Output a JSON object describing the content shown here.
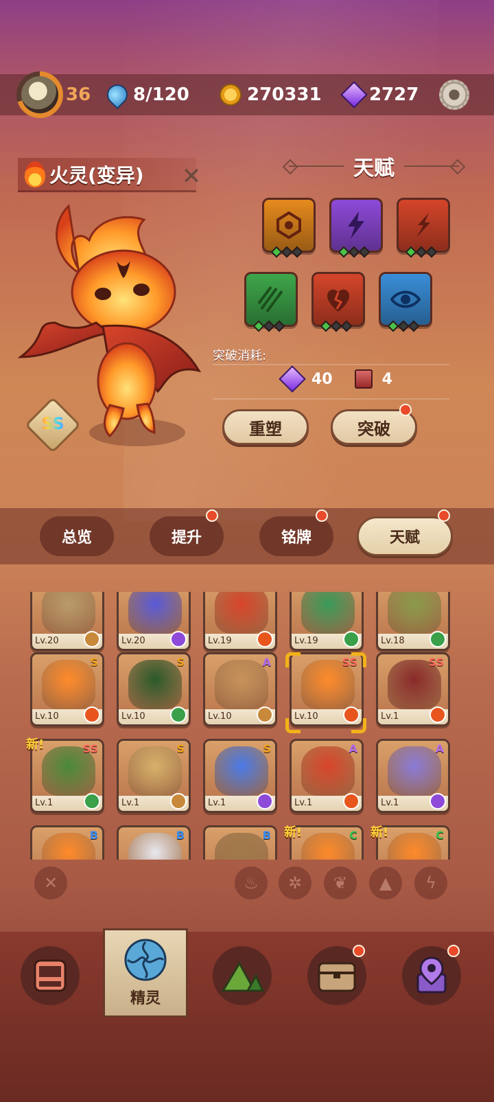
{
  "player": {
    "level": "36"
  },
  "resources": {
    "energy": "8/120",
    "coins": "270331",
    "gems": "2727"
  },
  "spirit": {
    "name": "火灵(变异)",
    "rank": "SS"
  },
  "talent": {
    "title": "天赋",
    "cost_label": "突破消耗:",
    "cost_gems": "40",
    "cost_books": "4",
    "reshape_label": "重塑",
    "breakthrough_label": "突破",
    "tiles": [
      {
        "icon": "gem-shield-icon",
        "color": "#e68a1e"
      },
      {
        "icon": "lightning-icon",
        "color": "#8e4ad8"
      },
      {
        "icon": "slash-icon",
        "color": "#d4452a"
      },
      {
        "icon": "claw-icon",
        "color": "#3ea64a"
      },
      {
        "icon": "broken-heart-icon",
        "color": "#d4452a"
      },
      {
        "icon": "eye-icon",
        "color": "#3a8ed8"
      }
    ]
  },
  "tabs": [
    "总览",
    "提升",
    "铭牌",
    "天赋"
  ],
  "cards": [
    {
      "level": "Lv.20",
      "rank": "",
      "element": "earth"
    },
    {
      "level": "Lv.20",
      "rank": "",
      "element": "lightning"
    },
    {
      "level": "Lv.19",
      "rank": "",
      "element": "fire"
    },
    {
      "level": "Lv.19",
      "rank": "",
      "element": "wood"
    },
    {
      "level": "Lv.18",
      "rank": "",
      "element": "wood"
    },
    {
      "level": "Lv.10",
      "rank": "S",
      "element": "fire"
    },
    {
      "level": "Lv.10",
      "rank": "S",
      "element": "wood"
    },
    {
      "level": "Lv.10",
      "rank": "A",
      "element": "earth"
    },
    {
      "level": "Lv.10",
      "rank": "SS",
      "element": "fire"
    },
    {
      "level": "Lv.1",
      "rank": "SS",
      "element": "fire"
    },
    {
      "level": "Lv.1",
      "rank": "SS",
      "element": "wood"
    },
    {
      "level": "Lv.1",
      "rank": "S",
      "element": "earth"
    },
    {
      "level": "Lv.1",
      "rank": "S",
      "element": "lightning"
    },
    {
      "level": "Lv.1",
      "rank": "A",
      "element": "fire"
    },
    {
      "level": "Lv.1",
      "rank": "A",
      "element": "lightning"
    },
    {
      "level": "",
      "rank": "B",
      "element": ""
    },
    {
      "level": "",
      "rank": "B",
      "element": ""
    },
    {
      "level": "",
      "rank": "B",
      "element": ""
    },
    {
      "level": "",
      "rank": "C",
      "element": ""
    },
    {
      "level": "",
      "rank": "C",
      "element": ""
    }
  ],
  "new_tag": "新!",
  "nav": {
    "selected_label": "精灵"
  },
  "colors": {
    "fire": "#e8561e",
    "wood": "#3aa04a",
    "earth": "#c88a3a",
    "lightning": "#8e4ad8",
    "rank_S": "#f2a21a",
    "rank_A": "#b06ae8",
    "rank_B": "#3a8ef2",
    "rank_C": "#3ac24a"
  }
}
